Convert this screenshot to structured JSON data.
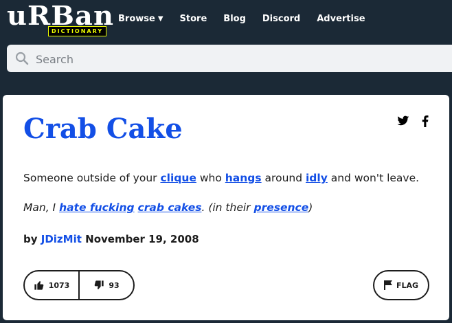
{
  "logo": {
    "main": "uRBan",
    "sub": "DICTIONARY"
  },
  "nav": {
    "browse": "Browse",
    "store": "Store",
    "blog": "Blog",
    "discord": "Discord",
    "advertise": "Advertise"
  },
  "search": {
    "placeholder": "Search"
  },
  "entry": {
    "word": "Crab Cake",
    "meaning": {
      "p1": "Someone outside of your ",
      "l1": "clique",
      "p2": " who ",
      "l2": "hangs",
      "p3": " around ",
      "l3": "idly",
      "p4": " and won't leave."
    },
    "example": {
      "p1": "Man, I ",
      "l1": "hate fucking",
      "p2": " ",
      "l2": "crab cakes",
      "p3": ". (in their ",
      "l3": "presence",
      "p4": ")"
    },
    "contributor": {
      "by": "by",
      "author": "JDizMit",
      "date": "November 19, 2008"
    },
    "upvotes": "1073",
    "downvotes": "93",
    "flag": "FLAG"
  },
  "colors": {
    "header_bg": "#1b2936",
    "link": "#134fe6",
    "logo_accent": "#efff00"
  },
  "icons": [
    "search-icon",
    "caret-down-icon",
    "twitter-icon",
    "facebook-icon",
    "thumbs-up-icon",
    "thumbs-down-icon",
    "flag-icon"
  ]
}
